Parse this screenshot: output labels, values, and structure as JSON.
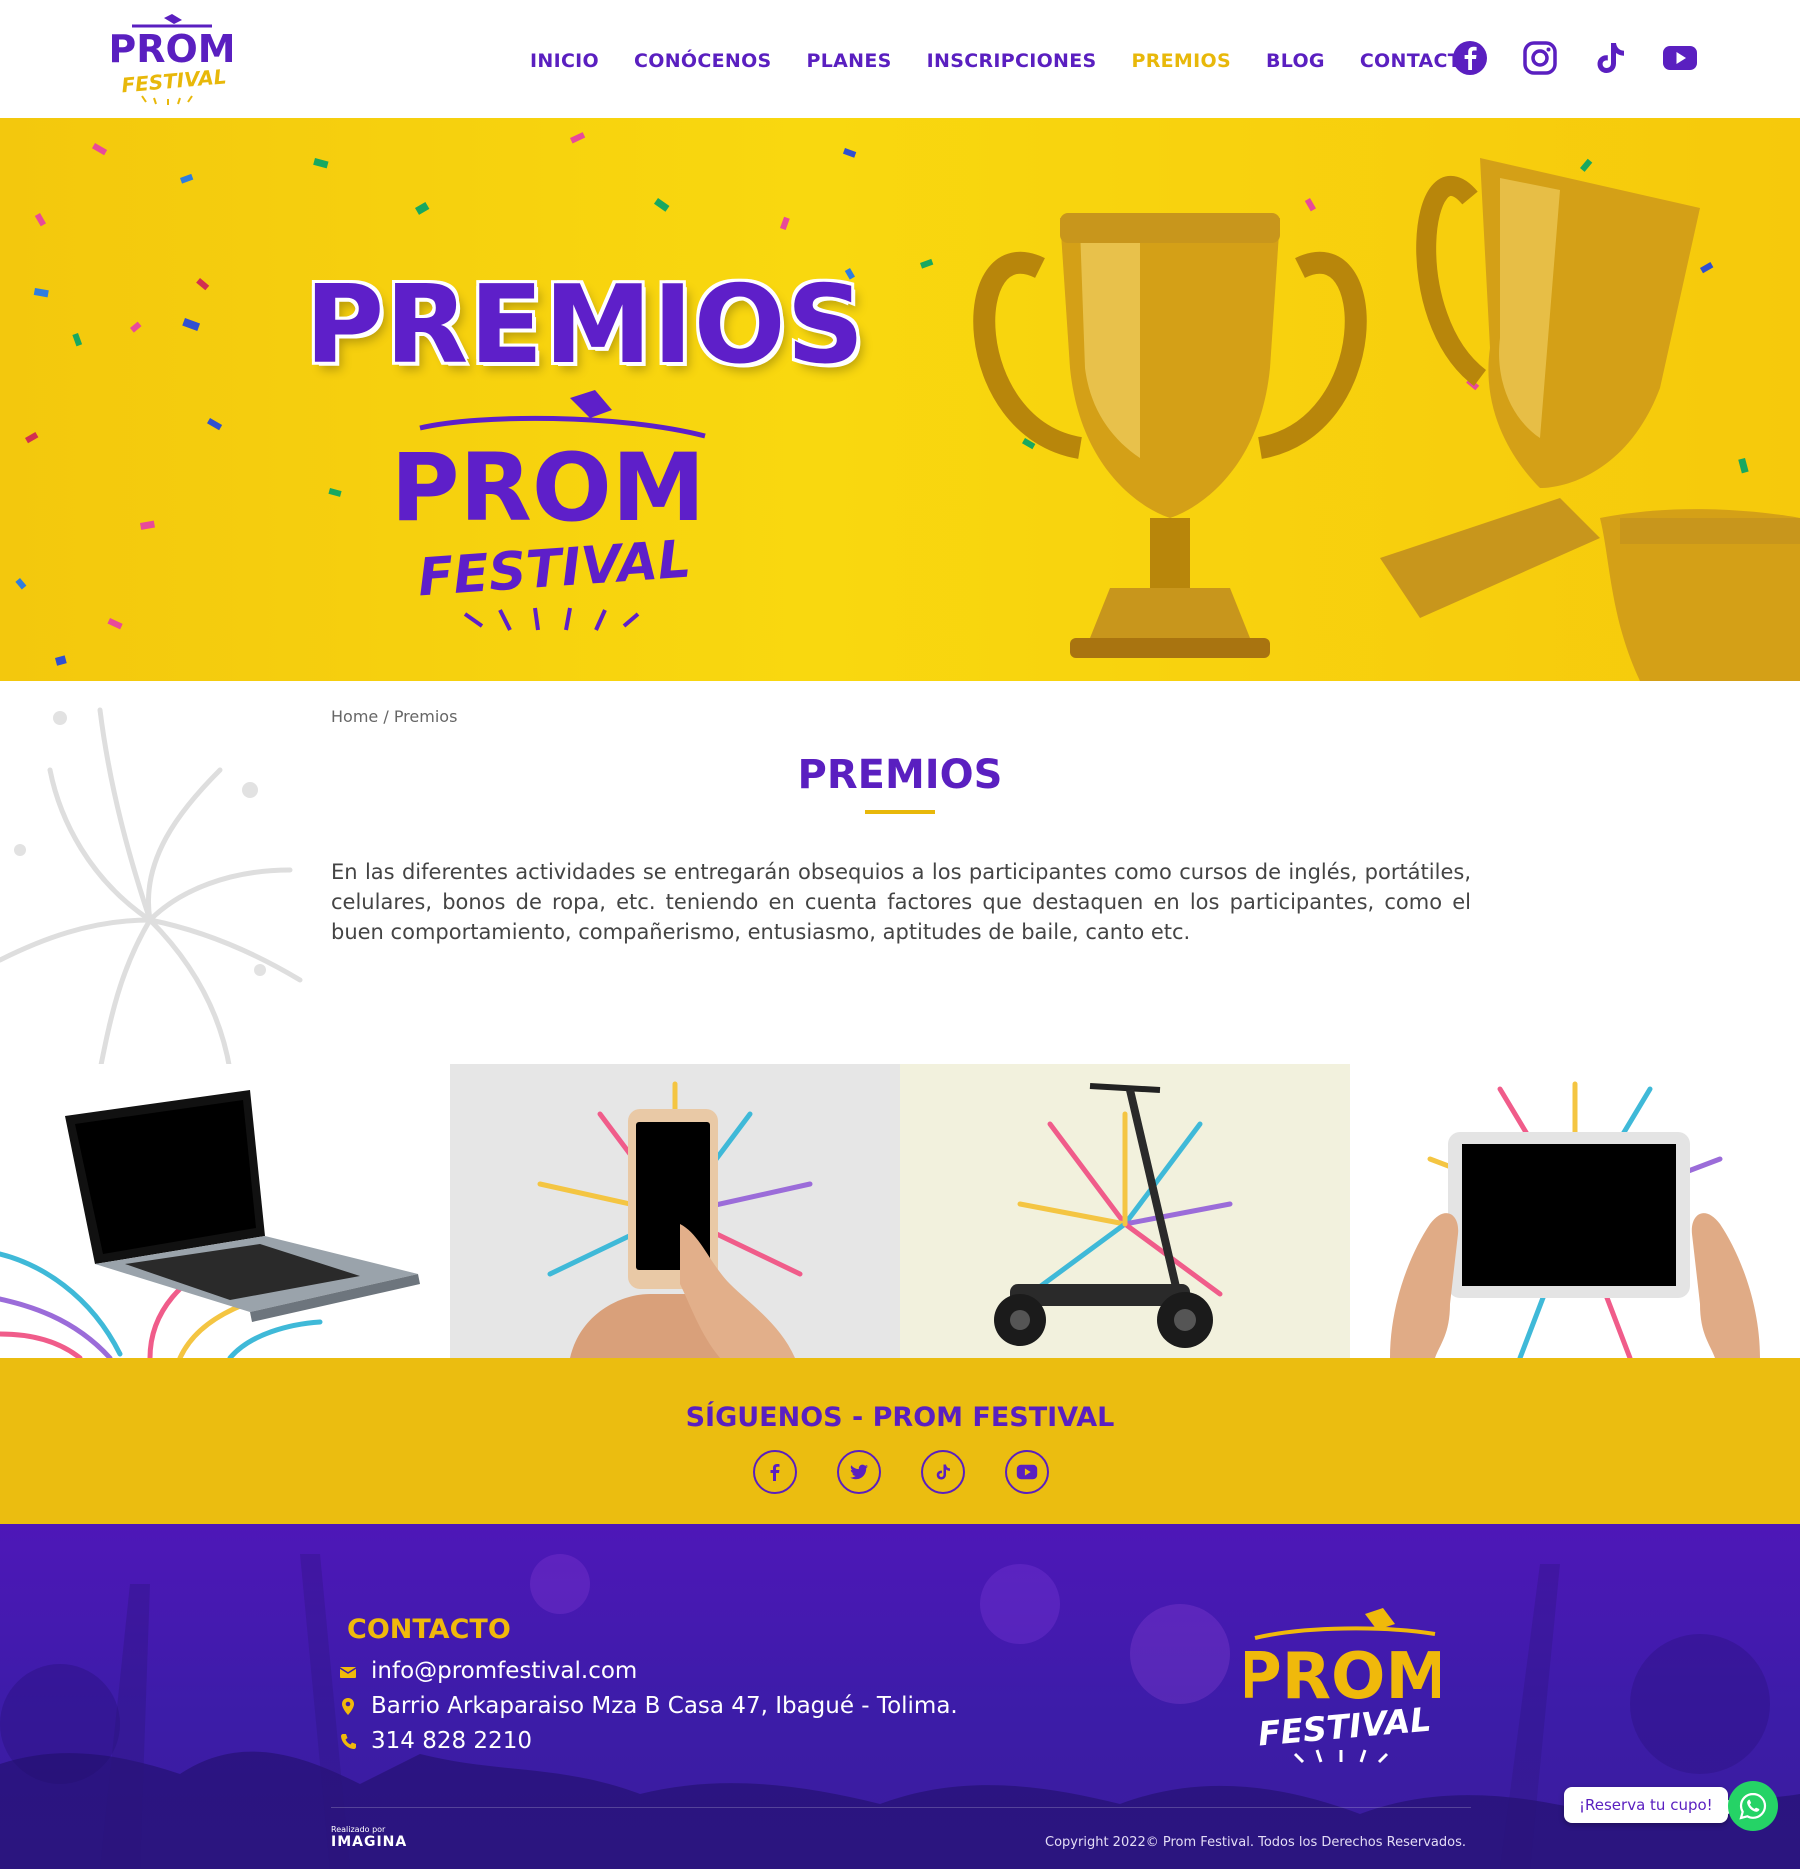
{
  "header": {
    "logo": {
      "line1": "PROM",
      "line2": "FESTIVAL"
    },
    "nav": [
      {
        "label": "INICIO"
      },
      {
        "label": "CONÓCENOS"
      },
      {
        "label": "PLANES"
      },
      {
        "label": "INSCRIPCIONES"
      },
      {
        "label": "PREMIOS",
        "active": true
      },
      {
        "label": "BLOG"
      },
      {
        "label": "CONTACTO"
      }
    ],
    "social": [
      "facebook-icon",
      "instagram-icon",
      "tiktok-icon",
      "youtube-icon"
    ]
  },
  "hero": {
    "title": "PREMIOS",
    "logo": {
      "line1": "PROM",
      "line2": "FESTIVAL"
    }
  },
  "breadcrumb": {
    "home": "Home",
    "separator": " / ",
    "current": "Premios"
  },
  "content": {
    "title": "PREMIOS",
    "intro": "En las diferentes actividades se entregarán obsequios a los participantes como cursos de inglés, portátiles, celulares, bonos de ropa, etc. teniendo en cuenta factores que destaquen en los participantes, como el buen comportamiento, compañerismo, entusiasmo, aptitudes de baile, canto etc."
  },
  "gallery": [
    "laptop-image",
    "smartphone-image",
    "scooter-image",
    "tablet-image"
  ],
  "follow": {
    "title": "SÍGUENOS - PROM FESTIVAL",
    "icons": [
      "facebook-icon",
      "twitter-icon",
      "tiktok-icon",
      "youtube-icon"
    ]
  },
  "footer": {
    "contact_title": "CONTACTO",
    "email": "info@promfestival.com",
    "address": "Barrio Arkaparaiso Mza B Casa 47, Ibagué - Tolima.",
    "phone": "314 828 2210",
    "logo": {
      "line1": "PROM",
      "line2": "FESTIVAL"
    },
    "made_by_label": "Realizado por",
    "made_by_brand": "IMAGINA",
    "copyright": "Copyright 2022© Prom Festival. Todos los Derechos Reservados."
  },
  "whatsapp": {
    "label": "¡Reserva tu cupo!"
  },
  "colors": {
    "purple": "#5a1fc0",
    "yellow": "#ebbd10",
    "gold": "#e8b80a",
    "whatsapp": "#25d366"
  }
}
